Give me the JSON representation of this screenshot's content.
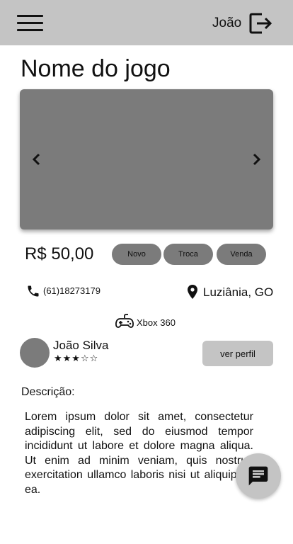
{
  "header": {
    "user_name": "João",
    "menu_icon": "hamburger-menu-icon",
    "logout_icon": "logout-icon"
  },
  "game": {
    "title": "Nome do jogo",
    "price": "R$ 50,00",
    "tags": [
      "Novo",
      "Troca",
      "Venda"
    ],
    "phone": "(61)18273179",
    "location": "Luziânia, GO",
    "platform": "Xbox 360"
  },
  "carousel": {
    "prev_icon": "chevron-left-icon",
    "next_icon": "chevron-right-icon"
  },
  "seller": {
    "name": "João Silva",
    "rating": 3,
    "rating_max": 5,
    "stars_text": "★★★☆☆",
    "profile_button": "ver perfil"
  },
  "description": {
    "label": "Descrição:",
    "text": "Lorem ipsum dolor sit amet, consectetur adipiscing elit, sed do eiusmod tempor incididunt ut labore et dolore magna aliqua. Ut enim ad minim veniam, quis nostrud exercitation ullamco laboris nisi ut aliquip ex ea."
  },
  "chat": {
    "icon": "chat-icon"
  },
  "colors": {
    "topbar": "#c4c4c4",
    "placeholder": "#7b7b7b",
    "button": "#c4c4c4",
    "text": "#111111"
  }
}
